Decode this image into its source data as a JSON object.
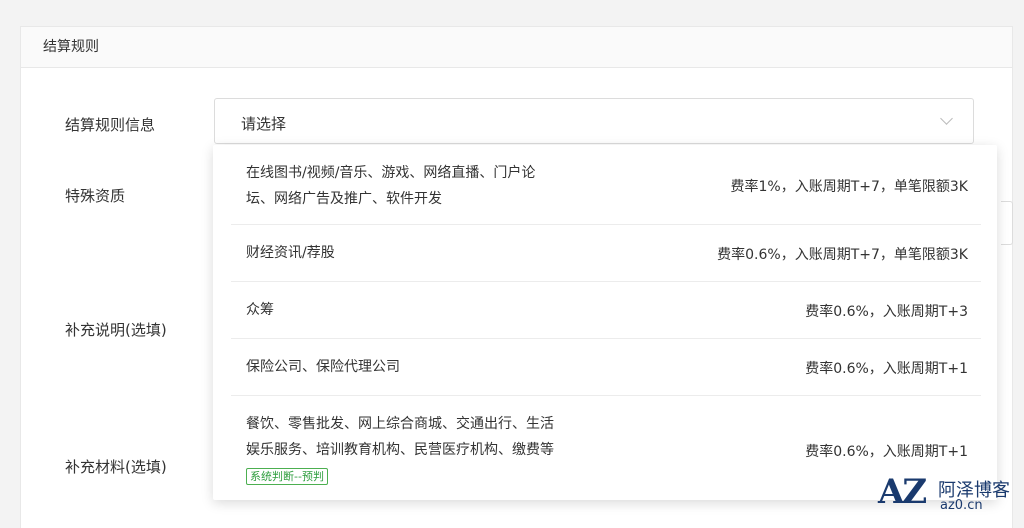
{
  "section": {
    "title": "结算规则"
  },
  "form": {
    "settle_rule_label": "结算规则信息",
    "special_qual_label": "特殊资质",
    "extra_desc_label": "补充说明(选填)",
    "extra_material_label": "补充材料(选填)",
    "select_placeholder": "请选择"
  },
  "dropdown": {
    "options": [
      {
        "name_line1": "在线图书/视频/音乐、游戏、网络直播、门户论",
        "name_line2": "坛、网络广告及推广、软件开发",
        "rate": "费率1%，入账周期T+7，单笔限额3K"
      },
      {
        "name_line1": "财经资讯/荐股",
        "rate": "费率0.6%，入账周期T+7，单笔限额3K"
      },
      {
        "name_line1": "众筹",
        "rate": "费率0.6%，入账周期T+3"
      },
      {
        "name_line1": "保险公司、保险代理公司",
        "rate": "费率0.6%，入账周期T+1"
      },
      {
        "name_line1": "餐饮、零售批发、网上综合商城、交通出行、生活",
        "name_line2": "娱乐服务、培训教育机构、民营医疗机构、缴费等",
        "tag": "系统判断--预判",
        "rate": "费率0.6%，入账周期T+1"
      }
    ]
  },
  "watermark": {
    "logo": "AZ",
    "name": "阿泽博客",
    "site": "az0.cn"
  }
}
